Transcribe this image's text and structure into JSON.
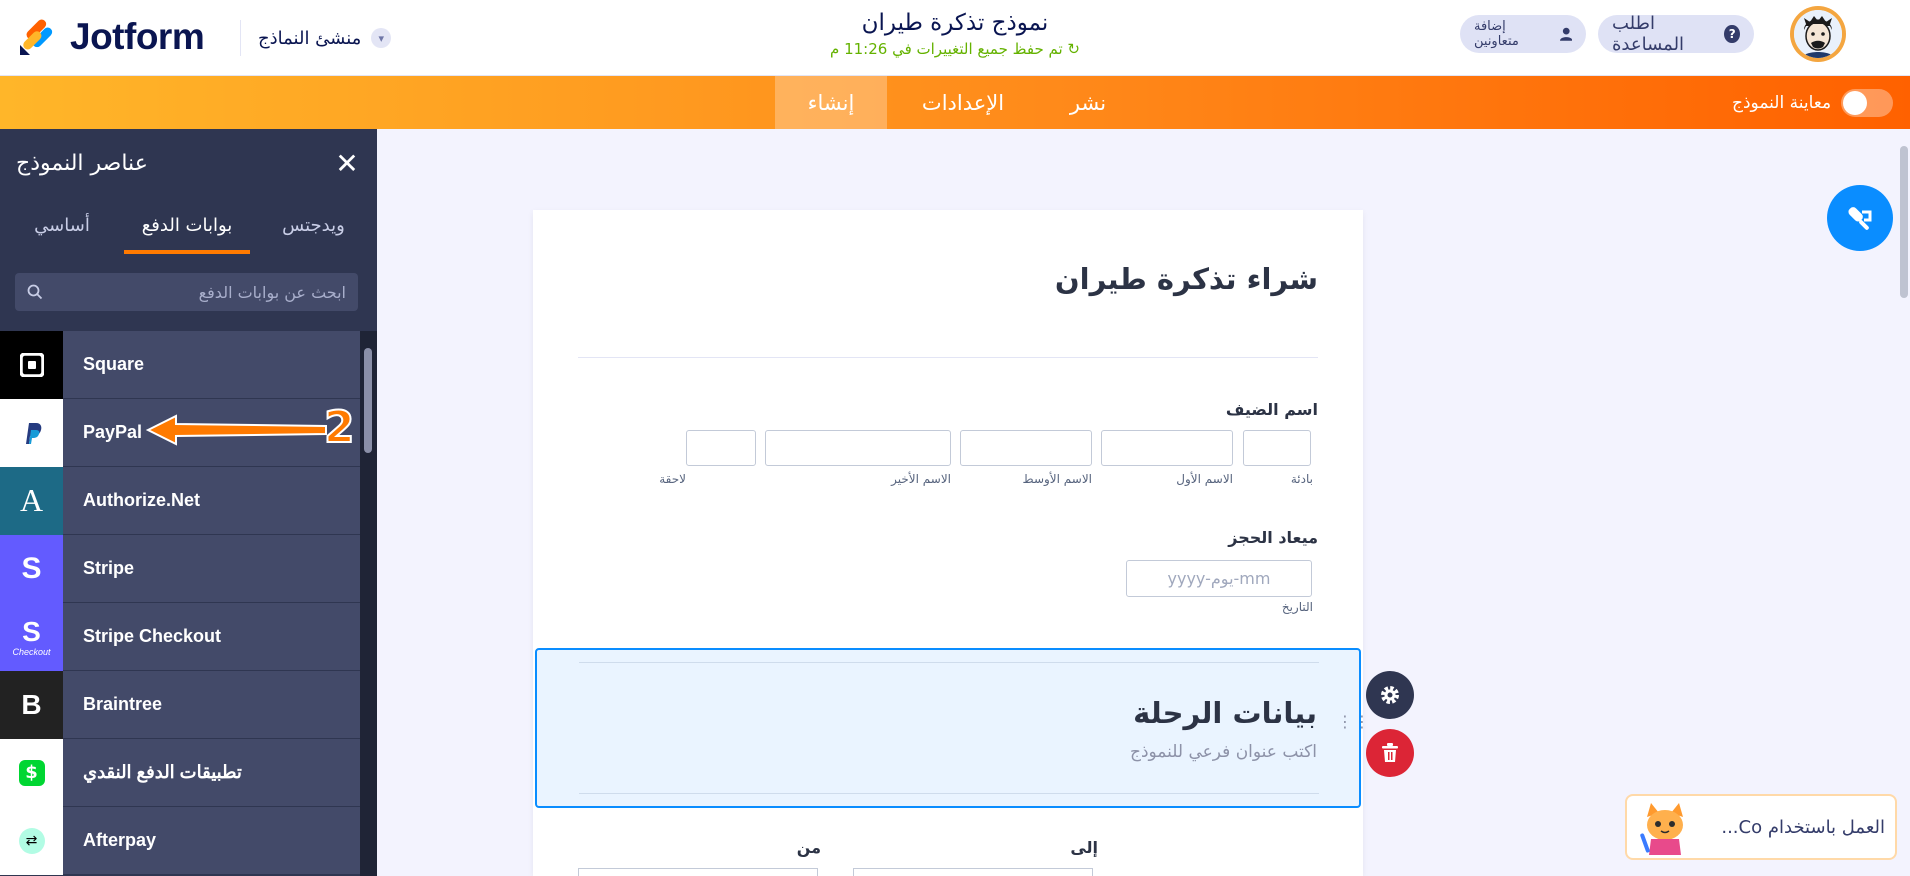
{
  "header": {
    "logo_text": "Jotform",
    "builder_label": "منشئ النماذج",
    "form_title": "نموذج تذكرة طيران",
    "save_status": "↻ تم حفظ جميع التغييرات في 11:26 م",
    "help_label": "اطلب المساعدة",
    "invite_label": "إضافة متعاونين"
  },
  "nav": {
    "tabs": [
      {
        "label": "إنشاء"
      },
      {
        "label": "الإعدادات"
      },
      {
        "label": "نشر"
      }
    ],
    "preview_label": "معاينة النموذج"
  },
  "panel": {
    "title": "عناصر النموذج",
    "tabs": [
      {
        "label": "ويدجتس"
      },
      {
        "label": "بوابات الدفع"
      },
      {
        "label": "أساسي"
      }
    ],
    "search_placeholder": "ابحث عن بوابات الدفع",
    "items": [
      {
        "label": "Square",
        "icon": "square-logo-icon"
      },
      {
        "label": "PayPal",
        "icon": "paypal-logo-icon"
      },
      {
        "label": "Authorize.Net",
        "icon": "authorize-net-logo-icon"
      },
      {
        "label": "Stripe",
        "icon": "stripe-logo-icon"
      },
      {
        "label": "Stripe Checkout",
        "icon": "stripe-checkout-logo-icon",
        "icon_caption": "Checkout"
      },
      {
        "label": "Braintree",
        "icon": "braintree-logo-icon"
      },
      {
        "label": "تطبيقات الدفع النقدي",
        "icon": "cash-app-logo-icon"
      },
      {
        "label": "Afterpay",
        "icon": "afterpay-logo-icon"
      }
    ]
  },
  "form": {
    "heading": "شراء تذكرة طيران",
    "guest_name_label": "اسم الضيف",
    "name_sublabels": {
      "prefix": "بادئة",
      "first": "الاسم الأول",
      "middle": "الاسم الأوسط",
      "last": "الاسم الأخير",
      "suffix": "لاحقة"
    },
    "booking_label": "ميعاد الحجز",
    "date_placeholder": "yyyy-يوم-mm",
    "date_sublabel": "التاريخ",
    "section_title": "بيانات الرحلة",
    "section_sub_placeholder": "اكتب عنوان فرعي للنموذج",
    "to_label": "إلى",
    "from_label": "من"
  },
  "annotation": {
    "number": "2"
  },
  "ai_assistant": {
    "label": "العمل باستخدام Co..."
  },
  "colors": {
    "accent_orange": "#ff7a00",
    "panel_bg": "#2f3651",
    "selection_blue": "#0a8dff"
  }
}
